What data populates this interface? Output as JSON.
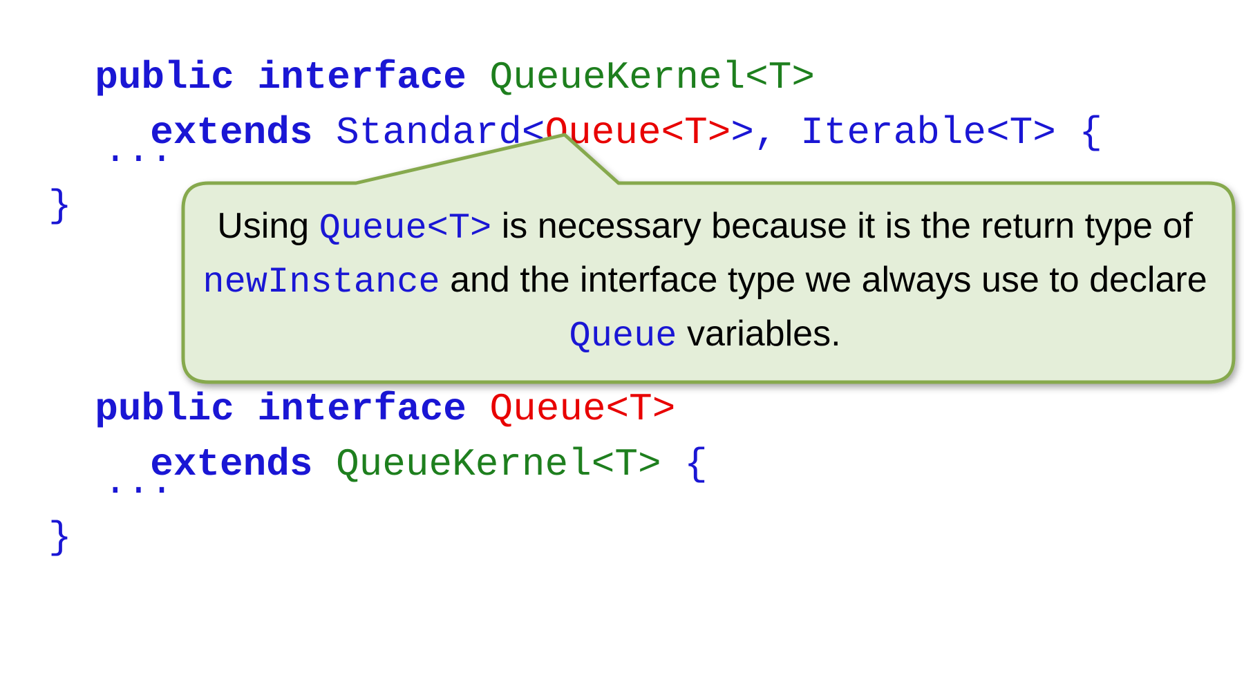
{
  "code": {
    "block1": {
      "line1": {
        "kw": "public interface ",
        "name": "QueueKernel<T>"
      },
      "line2": {
        "kw": "extends",
        "sp": " ",
        "standard_open": "Standard<",
        "queue_t": "Queue<T>",
        "close_rest": ">, Iterable<T> {"
      },
      "line3": "...",
      "line4": "}"
    },
    "block2": {
      "line1": {
        "kw": "public interface ",
        "name": "Queue<T>"
      },
      "line2": {
        "kw": "extends",
        "sp": " ",
        "name": "QueueKernel<T>",
        "brace": " {"
      },
      "line3": "...",
      "line4": "}"
    }
  },
  "callout": {
    "part1": "Using ",
    "code1": "Queue<T>",
    "part2": " is necessary because it is the return type of ",
    "code2": "newInstance",
    "part3": " and the interface type we always use to declare ",
    "code3": "Queue",
    "part4": " variables."
  },
  "colors": {
    "keyword": "#1a16d4",
    "type_green": "#1e7f1e",
    "highlight_red": "#e80000",
    "callout_fill": "#e4eed9",
    "callout_border": "#86a94e"
  }
}
